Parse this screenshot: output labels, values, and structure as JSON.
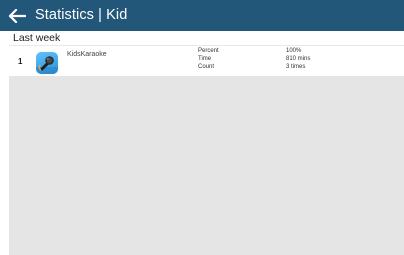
{
  "header": {
    "title": "Statistics | Kid",
    "back_icon": "arrow-left-icon",
    "background": "#23577a"
  },
  "section": {
    "title": "Last week"
  },
  "items": [
    {
      "rank": "1",
      "icon": "karaoke-microphone-icon",
      "name": "KidsKaraoke",
      "stats": [
        {
          "label": "Percent",
          "value": "100%"
        },
        {
          "label": "Time",
          "value": "810 mins"
        },
        {
          "label": "Count",
          "value": "3 times"
        }
      ]
    }
  ]
}
